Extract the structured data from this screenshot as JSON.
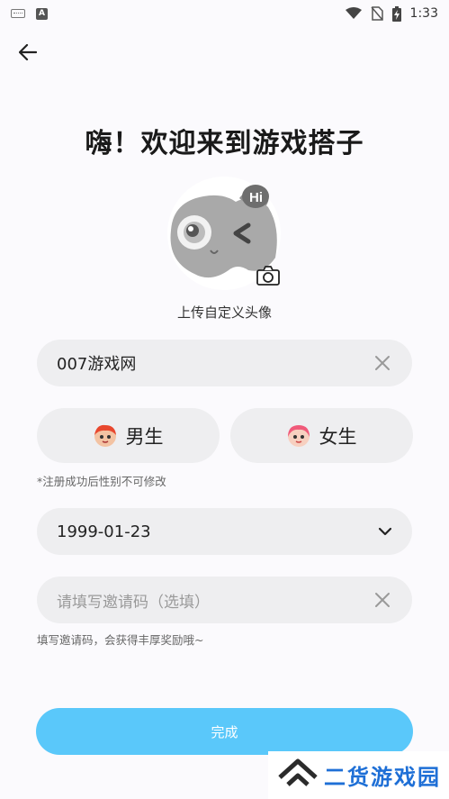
{
  "status_bar": {
    "time": "1:33",
    "a_icon": "A"
  },
  "header": {
    "title": "嗨！欢迎来到游戏搭子"
  },
  "avatar": {
    "upload_label": "上传自定义头像",
    "bubble_text": "Hi"
  },
  "nickname": {
    "value": "007游戏网"
  },
  "gender": {
    "male_label": "男生",
    "female_label": "女生",
    "note": "*注册成功后性别不可修改"
  },
  "birthday": {
    "value": "1999-01-23"
  },
  "invite": {
    "placeholder": "请填写邀请码（选填）",
    "note": "填写邀请码，会获得丰厚奖励哦~"
  },
  "submit": {
    "label": "完成"
  },
  "watermark": {
    "text": "二货游戏园"
  },
  "colors": {
    "primary": "#5ac8fa",
    "field_bg": "#eeeef0",
    "watermark": "#1e6fd6"
  }
}
